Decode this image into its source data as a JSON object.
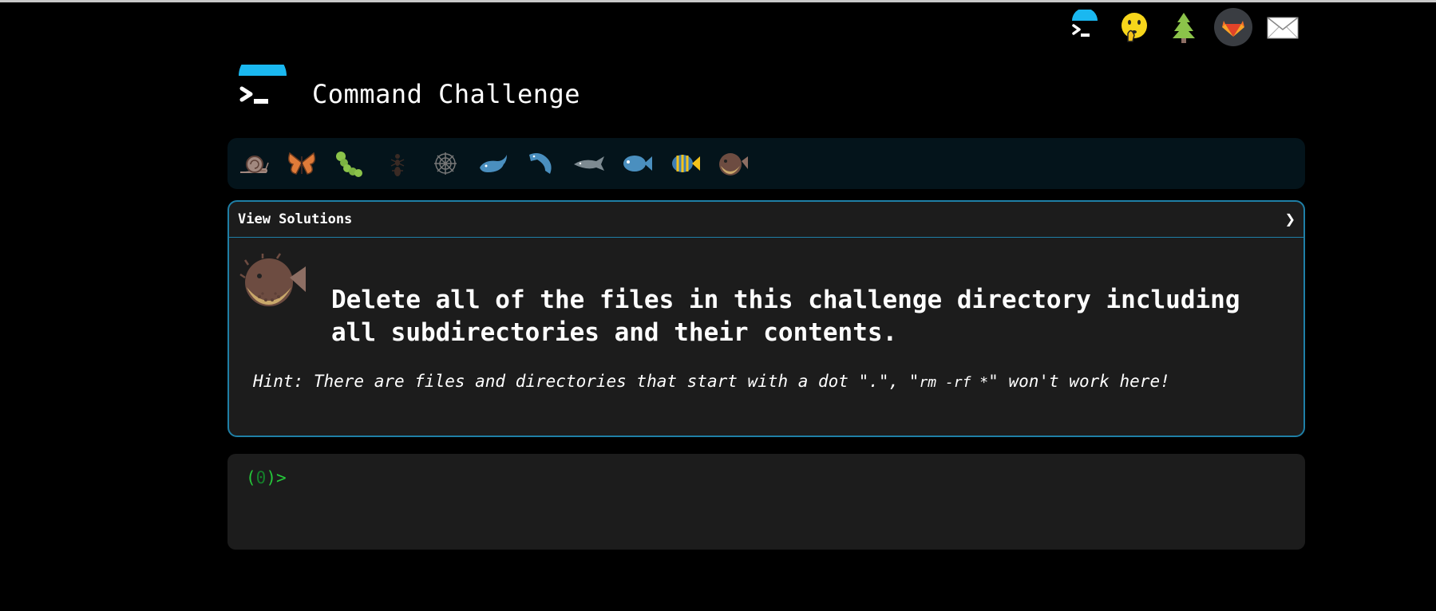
{
  "app": {
    "title": "Command Challenge"
  },
  "topbar": {
    "icons": [
      "terminal-logo-icon",
      "shushing-face-icon",
      "tree-icon",
      "gitlab-icon",
      "mail-icon"
    ]
  },
  "levels": [
    "snail",
    "butterfly",
    "caterpillar",
    "ant",
    "spider-web",
    "whale",
    "dolphin-jump",
    "dolphin",
    "fish",
    "tropical-fish",
    "blowfish"
  ],
  "card": {
    "header_label": "View Solutions",
    "chevron": "❯",
    "challenge": "Delete all of the files in this challenge directory including all subdirectories and their contents.",
    "hint_prefix": "Hint: There are files and directories that start with a dot \".\", \"",
    "hint_code": "rm -rf *",
    "hint_suffix": "\" won't work here!"
  },
  "terminal": {
    "prompt_open": "(",
    "prompt_count": "0",
    "prompt_close": ")>"
  },
  "colors": {
    "accent": "#1f7fa6",
    "logo_blue": "#1ab8f0",
    "prompt_green": "#25c73a"
  }
}
